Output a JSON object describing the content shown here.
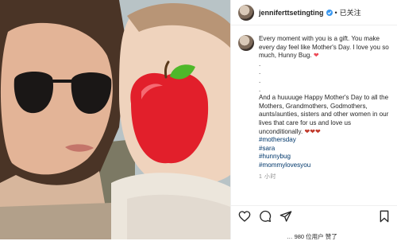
{
  "header": {
    "username": "jenniferttsetingting",
    "separator": "•",
    "follow_label": "已关注"
  },
  "caption": {
    "line1": "Every moment with you is a gift. You make every day feel like Mother's Day. I love you so much, Hunny Bug.",
    "dots": [
      ".",
      ".",
      ".",
      "."
    ],
    "line2": "And a huuuuge Happy Mother's Day to all the Mothers, Grandmothers, Godmothers, aunts/aunties, sisters and other women in our lives that care for us and love us unconditionally.",
    "hashtags": [
      "#mothersday",
      "#sara",
      "#hunnybug",
      "#mommylovesyou"
    ],
    "time": "1 小时"
  },
  "likes": {
    "text": "… 980 位用户 赞了"
  },
  "colors": {
    "verified": "#3897f0",
    "hashtag": "#00376b",
    "heart": "#ed4956",
    "apple": "#e21f2b",
    "leaf": "#4fb82a"
  },
  "icons": {
    "like": "heart-outline-icon",
    "comment": "speech-bubble-icon",
    "share": "paper-plane-icon",
    "save": "bookmark-icon"
  }
}
